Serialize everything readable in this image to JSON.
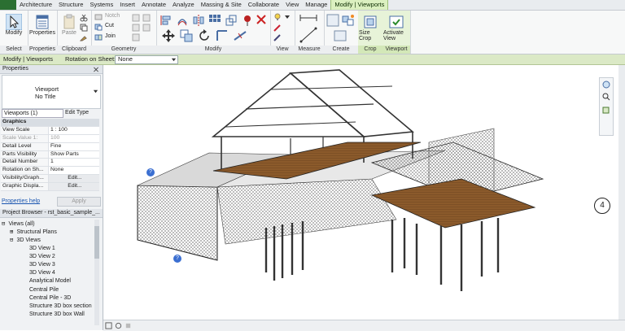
{
  "ribbon_tabs": [
    "Architecture",
    "Structure",
    "Systems",
    "Insert",
    "Annotate",
    "Analyze",
    "Massing & Site",
    "Collaborate",
    "View",
    "Manage",
    "Modify | Viewports"
  ],
  "ribbon": {
    "modify_label": "Modify",
    "select_label": "Select",
    "properties_label": "Properties",
    "paste_label": "Paste",
    "notch_label": "Notch",
    "cut_label": "Cut",
    "join_label": "Join",
    "size_crop_label": "Size Crop",
    "activate_view_label": "Activate View",
    "panels": [
      "Select",
      "Properties",
      "Clipboard",
      "Geometry",
      "Modify",
      "View",
      "Measure",
      "Create",
      "Crop",
      "Viewport"
    ]
  },
  "context_bar": {
    "title": "Modify | Viewports",
    "rotation_label": "Rotation on Sheet:",
    "rotation_value": "None"
  },
  "properties": {
    "header": "Properties",
    "type_line1": "Viewport",
    "type_line2": "No Title",
    "selector": "Viewports (1)",
    "edit_type": "Edit Type",
    "group": "Graphics",
    "rows": [
      {
        "k": "View Scale",
        "v": "1 : 100"
      },
      {
        "k": "Scale Value 1:",
        "v": "100"
      },
      {
        "k": "Detail Level",
        "v": "Fine"
      },
      {
        "k": "Parts Visibility",
        "v": "Show Parts"
      },
      {
        "k": "Detail Number",
        "v": "1"
      },
      {
        "k": "Rotation on Sh...",
        "v": "None"
      },
      {
        "k": "Visibility/Graph...",
        "v": "Edit..."
      },
      {
        "k": "Graphic Displa...",
        "v": "Edit..."
      }
    ],
    "help_link": "Properties help",
    "apply": "Apply"
  },
  "browser": {
    "header": "Project Browser - rst_basic_sample_...",
    "items": [
      {
        "label": "Views (all)",
        "indent": 0
      },
      {
        "label": "Structural Plans",
        "indent": 1
      },
      {
        "label": "3D Views",
        "indent": 1
      },
      {
        "label": "3D View 1",
        "indent": 3
      },
      {
        "label": "3D View 2",
        "indent": 3
      },
      {
        "label": "3D View 3",
        "indent": 3
      },
      {
        "label": "3D View 4",
        "indent": 3
      },
      {
        "label": "Analytical Model",
        "indent": 3
      },
      {
        "label": "Central Pile",
        "indent": 3
      },
      {
        "label": "Central Pile - 3D",
        "indent": 3
      },
      {
        "label": "Structure 3D box section",
        "indent": 3
      },
      {
        "label": "Structure 3D box Wall",
        "indent": 3
      }
    ]
  },
  "viewport": {
    "callout_number": "4"
  }
}
